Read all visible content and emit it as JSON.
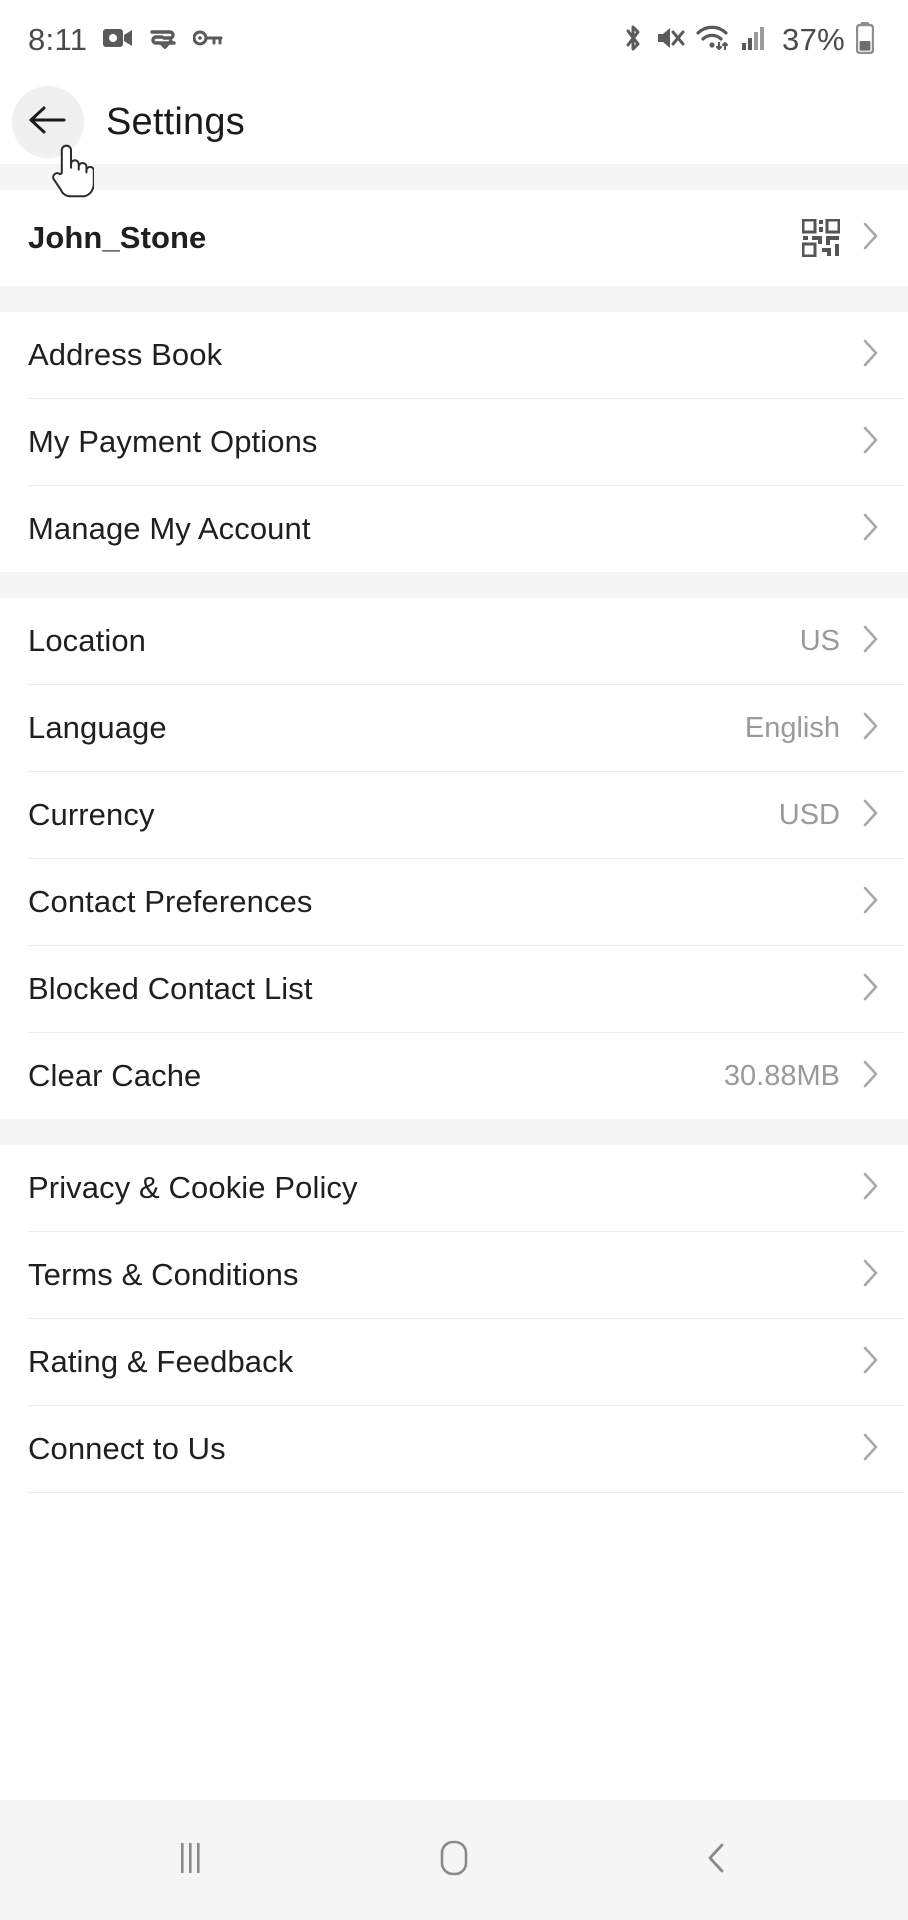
{
  "status_bar": {
    "time": "8:11",
    "battery_percent": "37%",
    "left_icons": [
      "video-camera-icon",
      "data-saver-check-icon",
      "key-icon"
    ],
    "right_icons": [
      "bluetooth-icon",
      "mute-speaker-icon",
      "wifi-icon",
      "cellular-signal-icon",
      "battery-icon"
    ]
  },
  "header": {
    "title": "Settings",
    "back_icon": "back-arrow-icon"
  },
  "account": {
    "username": "John_Stone",
    "qr_icon": "qr-code-icon"
  },
  "sections": [
    {
      "id": "account-section",
      "rows": [
        {
          "label": "Address Book",
          "value": ""
        },
        {
          "label": "My Payment Options",
          "value": ""
        },
        {
          "label": "Manage My Account",
          "value": ""
        }
      ]
    },
    {
      "id": "preferences-section",
      "rows": [
        {
          "label": "Location",
          "value": "US"
        },
        {
          "label": "Language",
          "value": "English"
        },
        {
          "label": "Currency",
          "value": "USD"
        },
        {
          "label": "Contact Preferences",
          "value": ""
        },
        {
          "label": "Blocked Contact List",
          "value": ""
        },
        {
          "label": "Clear Cache",
          "value": "30.88MB"
        }
      ]
    },
    {
      "id": "legal-section",
      "rows": [
        {
          "label": "Privacy & Cookie Policy",
          "value": ""
        },
        {
          "label": "Terms & Conditions",
          "value": ""
        },
        {
          "label": "Rating & Feedback",
          "value": ""
        },
        {
          "label": "Connect to Us",
          "value": ""
        }
      ]
    }
  ],
  "nav_bar": {
    "recents_label": "recents-icon",
    "home_label": "home-icon",
    "back_label": "back-icon"
  },
  "colors": {
    "background": "#ffffff",
    "section_gap": "#f4f5f4",
    "divider": "#ededed",
    "label_text": "#1f1f1f",
    "value_text": "#9a9a9a",
    "chevron": "#a8a8a8",
    "status_text": "#4a4a4a"
  }
}
